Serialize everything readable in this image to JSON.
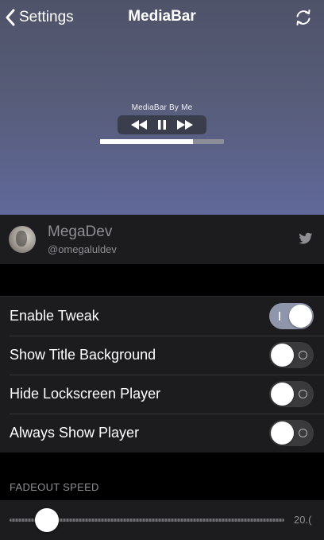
{
  "nav": {
    "back_label": "Settings",
    "title": "MediaBar",
    "back_icon": "chevron-left-icon",
    "refresh_icon": "refresh-icon"
  },
  "preview": {
    "bar_label": "MediaBar By Me",
    "controls": [
      "rewind-icon",
      "pause-icon",
      "fast-forward-icon"
    ],
    "progress": 0.75
  },
  "developer": {
    "name": "MegaDev",
    "handle": "@omegaluldev",
    "icon": "twitter-icon"
  },
  "settings": {
    "rows": [
      {
        "label": "Enable Tweak",
        "enabled": true
      },
      {
        "label": "Show Title Background",
        "enabled": false
      },
      {
        "label": "Hide Lockscreen Player",
        "enabled": false
      },
      {
        "label": "Always Show Player",
        "enabled": false
      }
    ]
  },
  "fadeout": {
    "header": "FADEOUT SPEED",
    "value_text": "20.(",
    "slider_fraction": 0.1
  },
  "colors": {
    "header_top": "#4f5369",
    "header_bottom": "#61699a",
    "cell_background": "#1c1c1e",
    "switch_on": "#8f95aa",
    "secondary_text": "#8e8e93"
  }
}
